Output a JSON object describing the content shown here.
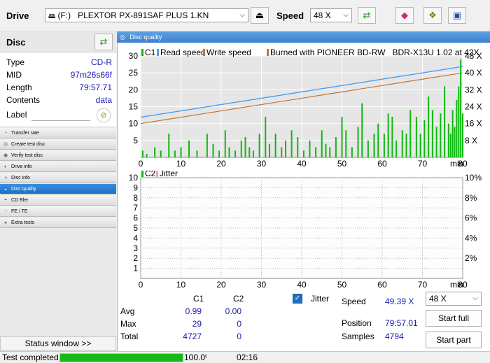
{
  "toolbar": {
    "drive_label": "Drive",
    "drive_letter": "(F:)",
    "drive_name": "PLEXTOR PX-891SAF PLUS 1.KN",
    "speed_label": "Speed",
    "speed_value": "48 X"
  },
  "disc": {
    "header": "Disc",
    "rows": [
      {
        "label": "Type",
        "value": "CD-R"
      },
      {
        "label": "MID",
        "value": "97m26s66f"
      },
      {
        "label": "Length",
        "value": "79:57.71"
      },
      {
        "label": "Contents",
        "value": "data"
      }
    ],
    "label_label": "Label"
  },
  "nav": {
    "items": [
      {
        "label": "Transfer rate"
      },
      {
        "label": "Create test disc"
      },
      {
        "label": "Verify test disc"
      },
      {
        "label": "Drive info"
      },
      {
        "label": "Disc info"
      },
      {
        "label": "Disc quality",
        "active": true
      },
      {
        "label": "CD Bler"
      },
      {
        "label": "FE / TE"
      },
      {
        "label": "Extra tests"
      }
    ],
    "status_window": "Status window >>"
  },
  "main": {
    "title": "Disc quality"
  },
  "chart_data": [
    {
      "type": "bar",
      "legend": [
        "C1",
        "Read speed",
        "Write speed",
        "Burned with PIONEER BD-RW   BDR-X13U 1.02 at 42X"
      ],
      "x_ticks": [
        "0",
        "10",
        "20",
        "30",
        "40",
        "50",
        "60",
        "70",
        "80"
      ],
      "x_unit": "min",
      "xlim": [
        0,
        80
      ],
      "ylim_left": [
        0,
        30
      ],
      "y_ticks_left": [
        "5",
        "10",
        "15",
        "20",
        "25",
        "30"
      ],
      "y_ticks_right": [
        "8 X",
        "16 X",
        "24 X",
        "32 X",
        "40 X",
        "48 X"
      ],
      "ylim_right": [
        0,
        48
      ],
      "series": [
        {
          "name": "Read speed",
          "color": "#4a9ef0",
          "x": [
            0,
            5,
            10,
            15,
            20,
            25,
            30,
            35,
            40,
            45,
            50,
            55,
            60,
            65,
            70,
            75,
            80
          ],
          "values": [
            19,
            20.5,
            22,
            23.5,
            25,
            26.5,
            28,
            29.5,
            31,
            32.5,
            34,
            35.5,
            37,
            38.5,
            40,
            41.5,
            43
          ]
        },
        {
          "name": "Write speed",
          "color": "#c0763a",
          "x": [
            0,
            5,
            10,
            15,
            20,
            25,
            30,
            35,
            40,
            45,
            50,
            55,
            60,
            65,
            70,
            75,
            80
          ],
          "values": [
            16,
            17.5,
            19,
            20.5,
            22,
            23.5,
            25,
            26.5,
            28,
            29.5,
            31,
            32.5,
            34,
            35.5,
            37,
            38.5,
            40
          ]
        },
        {
          "name": "C1",
          "color": "#0fb80f",
          "x": [
            0.5,
            1.5,
            3.5,
            5,
            7,
            8.5,
            10,
            12,
            14,
            16.5,
            18,
            19.5,
            21,
            22,
            23.5,
            25,
            26,
            27,
            28,
            29.5,
            31,
            32,
            33.5,
            35,
            36,
            37.5,
            39,
            40.5,
            42,
            43.5,
            45,
            46,
            47,
            48.5,
            50,
            51,
            52.5,
            54,
            55,
            56.5,
            58,
            59,
            60.5,
            61.5,
            62.5,
            63.5,
            65,
            66,
            67,
            68.5,
            69.5,
            70.5,
            71.5,
            72.5,
            73.5,
            74.5,
            75.5,
            76.5,
            77,
            77.5,
            78,
            78.5,
            79,
            79.5,
            80
          ],
          "values": [
            2,
            1,
            3,
            2,
            7,
            2,
            3,
            5,
            2,
            7,
            4,
            2,
            8,
            3,
            2,
            5,
            6,
            3,
            2,
            7,
            12,
            4,
            7,
            3,
            5,
            8,
            6,
            2,
            5,
            3,
            8,
            4,
            3,
            6,
            12,
            8,
            3,
            9,
            16,
            5,
            7,
            10,
            7,
            13,
            12,
            5,
            8,
            7,
            14,
            12,
            7,
            11,
            18,
            14,
            9,
            13,
            21,
            10,
            7,
            14,
            9,
            17,
            21,
            29,
            13
          ]
        }
      ]
    },
    {
      "type": "bar",
      "legend": [
        "C2",
        "Jitter"
      ],
      "x_ticks": [
        "0",
        "10",
        "20",
        "30",
        "40",
        "50",
        "60",
        "70",
        "80"
      ],
      "x_unit": "min",
      "xlim": [
        0,
        80
      ],
      "ylim_left": [
        0,
        10
      ],
      "y_ticks_left": [
        "1",
        "2",
        "3",
        "4",
        "5",
        "6",
        "7",
        "8",
        "9",
        "10"
      ],
      "y_ticks_right": [
        "2%",
        "4%",
        "6%",
        "8%",
        "10%"
      ],
      "ylim_right": [
        0,
        10
      ],
      "series": [
        {
          "name": "C2",
          "color": "#0fb80f",
          "x": [],
          "values": []
        },
        {
          "name": "Jitter",
          "color": "#e8a0d8",
          "x": [],
          "values": []
        }
      ]
    }
  ],
  "stats": {
    "col_c1": "C1",
    "col_c2": "C2",
    "rows": [
      {
        "label": "Avg",
        "c1": "0.99",
        "c2": "0.00"
      },
      {
        "label": "Max",
        "c1": "29",
        "c2": "0"
      },
      {
        "label": "Total",
        "c1": "4727",
        "c2": "0"
      }
    ],
    "jitter_label": "Jitter",
    "speed_label": "Speed",
    "speed_value": "49.39 X",
    "position_label": "Position",
    "position_value": "79:57.01",
    "samples_label": "Samples",
    "samples_value": "4794",
    "speed_select": "48 X",
    "start_full": "Start full",
    "start_part": "Start part"
  },
  "statusbar": {
    "text": "Test completed",
    "progress": 100,
    "progress_text": "100.0%",
    "time": "02:16"
  }
}
